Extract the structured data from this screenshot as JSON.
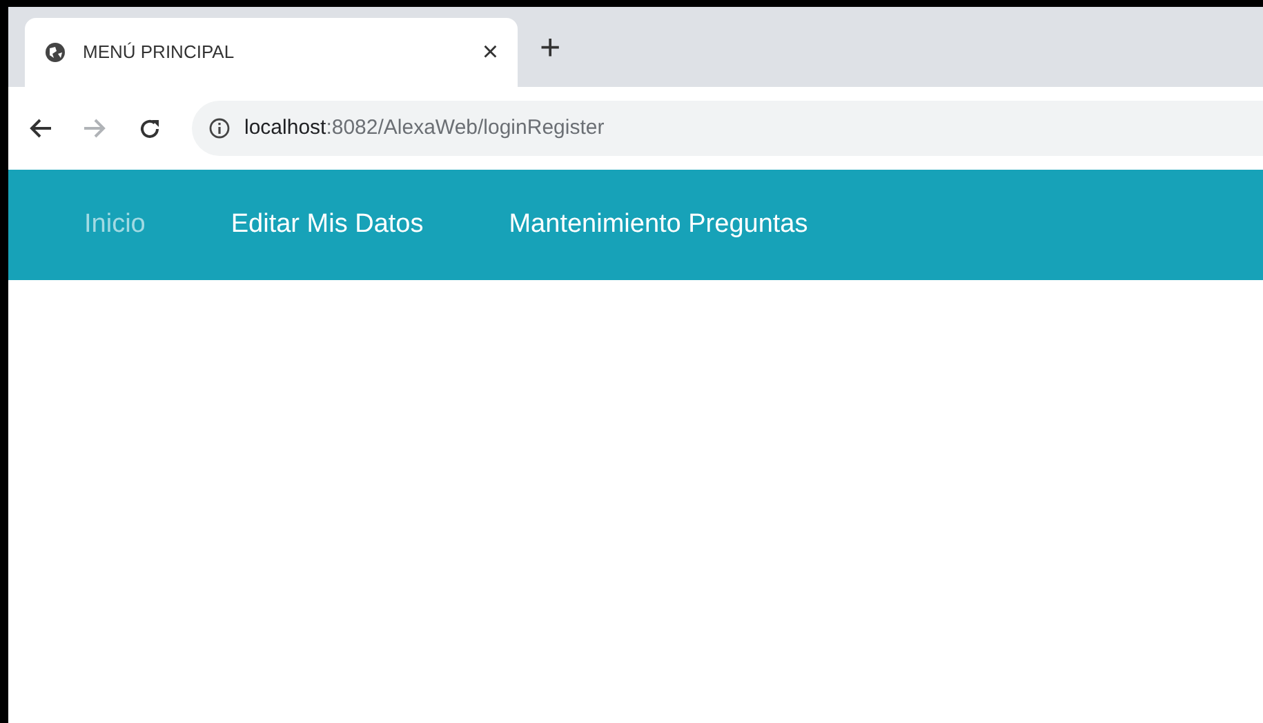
{
  "browser": {
    "tab": {
      "title": "MENÚ PRINCIPAL",
      "close": "×"
    },
    "new_tab": "+",
    "address": {
      "host": "localhost",
      "path": ":8082/AlexaWeb/loginRegister"
    },
    "forward_disabled": true
  },
  "navbar": {
    "items": [
      {
        "label": "Inicio",
        "muted": true
      },
      {
        "label": "Editar Mis Datos",
        "muted": false
      },
      {
        "label": "Mantenimiento Preguntas",
        "muted": false
      }
    ]
  }
}
